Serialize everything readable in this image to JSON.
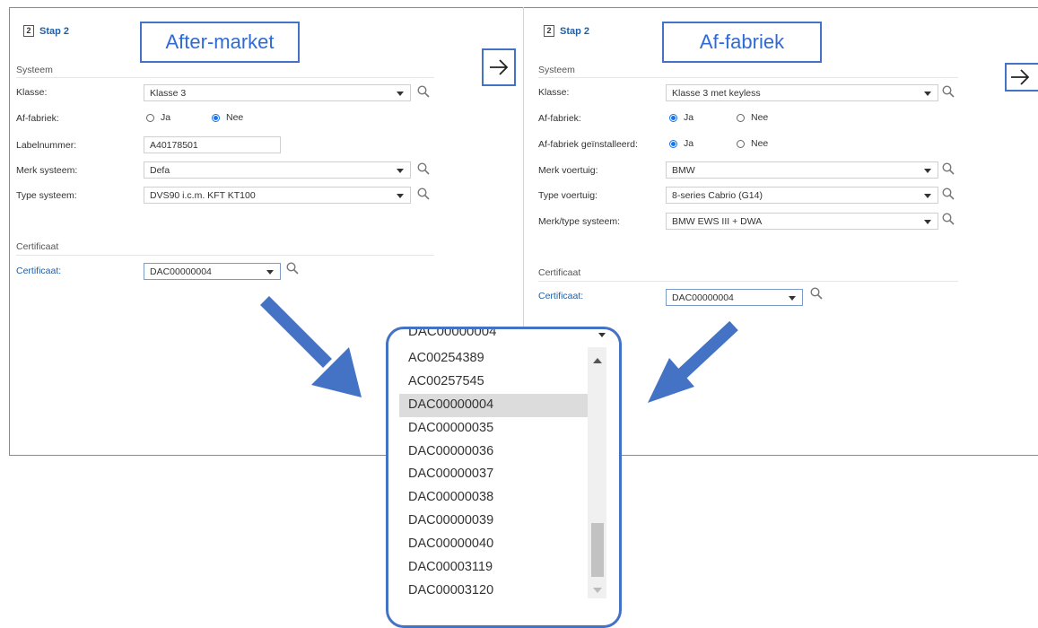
{
  "colors": {
    "accent": "#4472c4",
    "link": "#1f5fa8",
    "radio": "#1a73e8"
  },
  "left": {
    "step_num": "2",
    "step_label": "Stap 2",
    "title": "After-market",
    "section_systeem": "Systeem",
    "klasse_label": "Klasse:",
    "klasse_value": "Klasse 3",
    "affabriek_label": "Af-fabriek:",
    "ja": "Ja",
    "nee": "Nee",
    "affabriek_selected": "Nee",
    "labelnummer_label": "Labelnummer:",
    "labelnummer_value": "A40178501",
    "merk_label": "Merk systeem:",
    "merk_value": "Defa",
    "type_label": "Type systeem:",
    "type_value": "DVS90 i.c.m. KFT KT100",
    "section_certificaat": "Certificaat",
    "cert_label": "Certificaat:",
    "cert_value": "DAC00000004"
  },
  "right": {
    "step_num": "2",
    "step_label": "Stap 2",
    "title": "Af-fabriek",
    "section_systeem": "Systeem",
    "klasse_label": "Klasse:",
    "klasse_value": "Klasse 3 met keyless",
    "affabriek_label": "Af-fabriek:",
    "ja": "Ja",
    "nee": "Nee",
    "affabriek_selected": "Ja",
    "installed_label": "Af-fabriek geïnstalleerd:",
    "installed_selected": "Ja",
    "merk_voertuig_label": "Merk voertuig:",
    "merk_voertuig_value": "BMW",
    "type_voertuig_label": "Type voertuig:",
    "type_voertuig_value": "8-series Cabrio (G14)",
    "merk_type_label": "Merk/type systeem:",
    "merk_type_value": "BMW EWS III + DWA",
    "section_certificaat": "Certificaat",
    "cert_label": "Certificaat:",
    "cert_value": "DAC00000004"
  },
  "dropdown": {
    "current": "DAC00000004",
    "selected": "DAC00000004",
    "items": [
      "AC00254389",
      "AC00257545",
      "DAC00000004",
      "DAC00000035",
      "DAC00000036",
      "DAC00000037",
      "DAC00000038",
      "DAC00000039",
      "DAC00000040",
      "DAC00003119",
      "DAC00003120"
    ]
  },
  "icons": {
    "search": "search-icon",
    "next": "arrow-right-icon",
    "pointer": "pointer-arrow-icon"
  }
}
